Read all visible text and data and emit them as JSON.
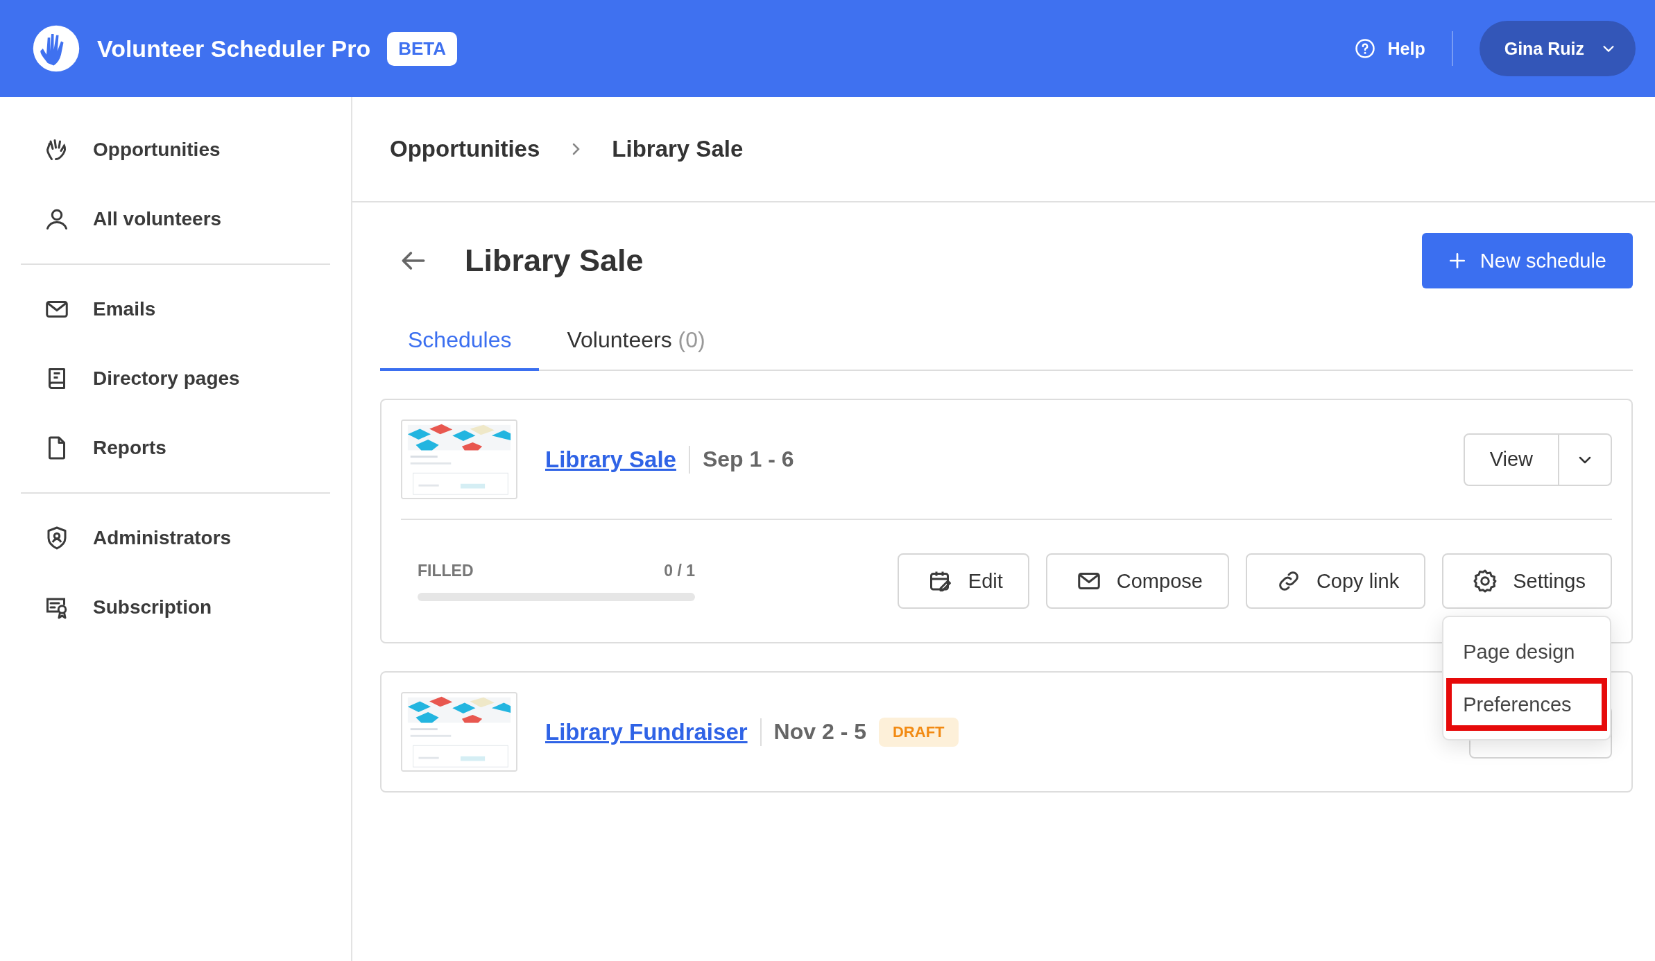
{
  "header": {
    "app_name": "Volunteer Scheduler Pro",
    "badge": "BETA",
    "help": "Help",
    "user": "Gina Ruiz"
  },
  "sidebar": {
    "groups": [
      [
        {
          "label": "Opportunities",
          "kind": "hand"
        },
        {
          "label": "All volunteers",
          "kind": "person"
        }
      ],
      [
        {
          "label": "Emails",
          "kind": "mail"
        },
        {
          "label": "Directory pages",
          "kind": "book"
        },
        {
          "label": "Reports",
          "kind": "file"
        }
      ],
      [
        {
          "label": "Administrators",
          "kind": "shield"
        },
        {
          "label": "Subscription",
          "kind": "certificate"
        }
      ]
    ]
  },
  "breadcrumb": [
    "Opportunities",
    "Library Sale"
  ],
  "page": {
    "title": "Library Sale",
    "new_button": "New schedule"
  },
  "tabs": [
    {
      "label": "Schedules",
      "selected": true
    },
    {
      "label": "Volunteers",
      "count": "(0)",
      "selected": false
    }
  ],
  "schedules": [
    {
      "name": "Library Sale",
      "dates": "Sep 1 - 6",
      "view": "View",
      "filled_label": "FILLED",
      "filled_count": "0 / 1",
      "level": 0,
      "actions": [
        {
          "label": "Edit",
          "kind": "edit"
        },
        {
          "label": "Compose",
          "kind": "mail"
        },
        {
          "label": "Copy link",
          "kind": "link"
        },
        {
          "label": "Settings",
          "kind": "gear"
        }
      ],
      "menu": [
        {
          "label": "Page design",
          "highlighted": false
        },
        {
          "label": "Preferences",
          "highlighted": true
        }
      ]
    },
    {
      "name": "Library Fundraiser",
      "dates": "Nov 2 - 5",
      "status": "DRAFT"
    }
  ]
}
